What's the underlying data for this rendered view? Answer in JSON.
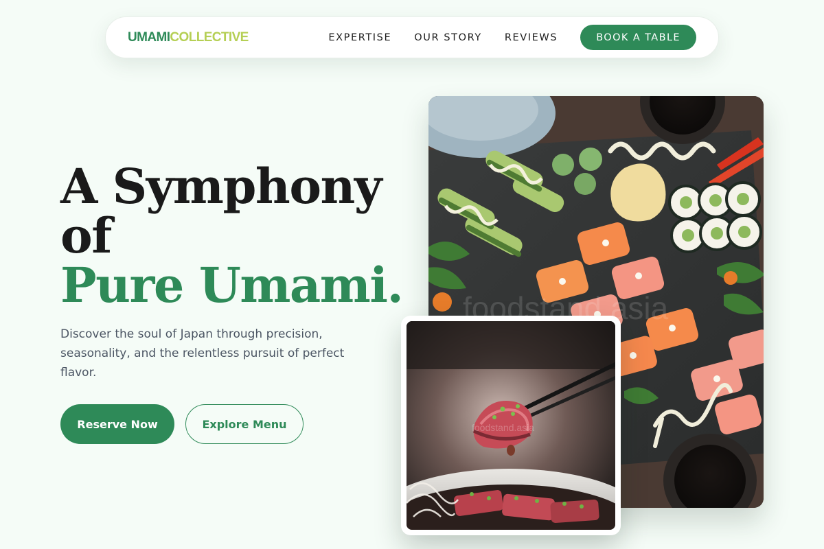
{
  "brand": {
    "part1": "UMAMI",
    "part2": "COLLECTIVE"
  },
  "nav": {
    "links": [
      "EXPERTISE",
      "OUR STORY",
      "REVIEWS"
    ],
    "cta": "BOOK A TABLE"
  },
  "hero": {
    "headline_line1": "A Symphony",
    "headline_line2": "of",
    "headline_line3": "Pure Umami.",
    "lead": "Discover the soul of Japan through precision, seasonality, and the relentless pursuit of perfect flavor.",
    "primary_button": "Reserve Now",
    "secondary_button": "Explore Menu"
  },
  "images": {
    "main_label": "sushi platter photo",
    "inset_label": "seared tuna with chopsticks photo"
  },
  "colors": {
    "accent": "#2e8a58",
    "logo_secondary": "#b5cf54",
    "background": "#f5fcf7",
    "text": "#1a1a1a",
    "muted": "#4b5563"
  }
}
